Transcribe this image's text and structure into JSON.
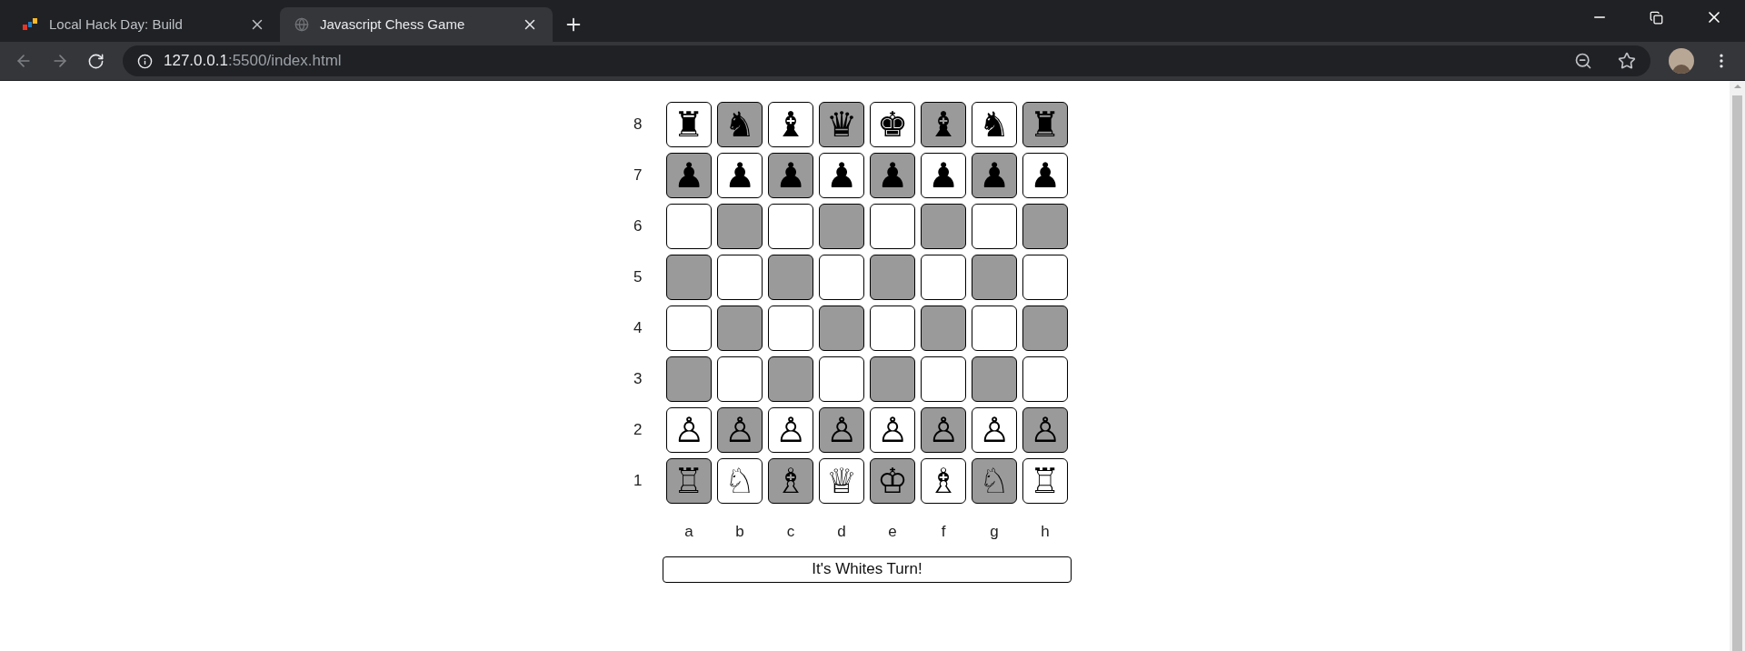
{
  "tabs": [
    {
      "title": "Local Hack Day: Build",
      "selected": false
    },
    {
      "title": "Javascript Chess Game",
      "selected": true
    }
  ],
  "address": {
    "host": "127.0.0.1",
    "path": ":5500/index.html"
  },
  "board": {
    "ranks": [
      "8",
      "7",
      "6",
      "5",
      "4",
      "3",
      "2",
      "1"
    ],
    "files": [
      "a",
      "b",
      "c",
      "d",
      "e",
      "f",
      "g",
      "h"
    ],
    "rows": [
      [
        {
          "kind": "piece",
          "glyph": "♜"
        },
        {
          "kind": "piece",
          "glyph": "♞"
        },
        {
          "kind": "piece",
          "glyph": "♝"
        },
        {
          "kind": "piece",
          "glyph": "♛"
        },
        {
          "kind": "piece",
          "glyph": "♚"
        },
        {
          "kind": "piece",
          "glyph": "♝"
        },
        {
          "kind": "piece",
          "glyph": "♞"
        },
        {
          "kind": "piece",
          "glyph": "♜"
        }
      ],
      [
        {
          "kind": "piece",
          "glyph": "♟"
        },
        {
          "kind": "piece",
          "glyph": "♟"
        },
        {
          "kind": "piece",
          "glyph": "♟"
        },
        {
          "kind": "piece",
          "glyph": "♟"
        },
        {
          "kind": "piece",
          "glyph": "♟"
        },
        {
          "kind": "piece",
          "glyph": "♟"
        },
        {
          "kind": "piece",
          "glyph": "♟"
        },
        {
          "kind": "piece",
          "glyph": "♟"
        }
      ],
      [
        {
          "kind": "empty"
        },
        {
          "kind": "empty"
        },
        {
          "kind": "empty"
        },
        {
          "kind": "empty"
        },
        {
          "kind": "empty"
        },
        {
          "kind": "empty"
        },
        {
          "kind": "empty"
        },
        {
          "kind": "empty"
        }
      ],
      [
        {
          "kind": "empty"
        },
        {
          "kind": "empty"
        },
        {
          "kind": "empty"
        },
        {
          "kind": "empty"
        },
        {
          "kind": "empty"
        },
        {
          "kind": "empty"
        },
        {
          "kind": "empty"
        },
        {
          "kind": "empty"
        }
      ],
      [
        {
          "kind": "empty"
        },
        {
          "kind": "empty"
        },
        {
          "kind": "empty"
        },
        {
          "kind": "empty"
        },
        {
          "kind": "empty"
        },
        {
          "kind": "empty"
        },
        {
          "kind": "empty"
        },
        {
          "kind": "empty"
        }
      ],
      [
        {
          "kind": "empty"
        },
        {
          "kind": "empty"
        },
        {
          "kind": "empty"
        },
        {
          "kind": "empty"
        },
        {
          "kind": "empty"
        },
        {
          "kind": "empty"
        },
        {
          "kind": "empty"
        },
        {
          "kind": "empty"
        }
      ],
      [
        {
          "kind": "piece",
          "glyph": "♙"
        },
        {
          "kind": "piece",
          "glyph": "♙"
        },
        {
          "kind": "piece",
          "glyph": "♙"
        },
        {
          "kind": "piece",
          "glyph": "♙"
        },
        {
          "kind": "piece",
          "glyph": "♙"
        },
        {
          "kind": "piece",
          "glyph": "♙"
        },
        {
          "kind": "piece",
          "glyph": "♙"
        },
        {
          "kind": "piece",
          "glyph": "♙"
        }
      ],
      [
        {
          "kind": "piece",
          "glyph": "♖"
        },
        {
          "kind": "piece",
          "glyph": "♘"
        },
        {
          "kind": "piece",
          "glyph": "♗"
        },
        {
          "kind": "piece",
          "glyph": "♕"
        },
        {
          "kind": "piece",
          "glyph": "♔"
        },
        {
          "kind": "piece",
          "glyph": "♗"
        },
        {
          "kind": "piece",
          "glyph": "♘"
        },
        {
          "kind": "piece",
          "glyph": "♖"
        }
      ]
    ]
  },
  "status": "It's Whites Turn!"
}
